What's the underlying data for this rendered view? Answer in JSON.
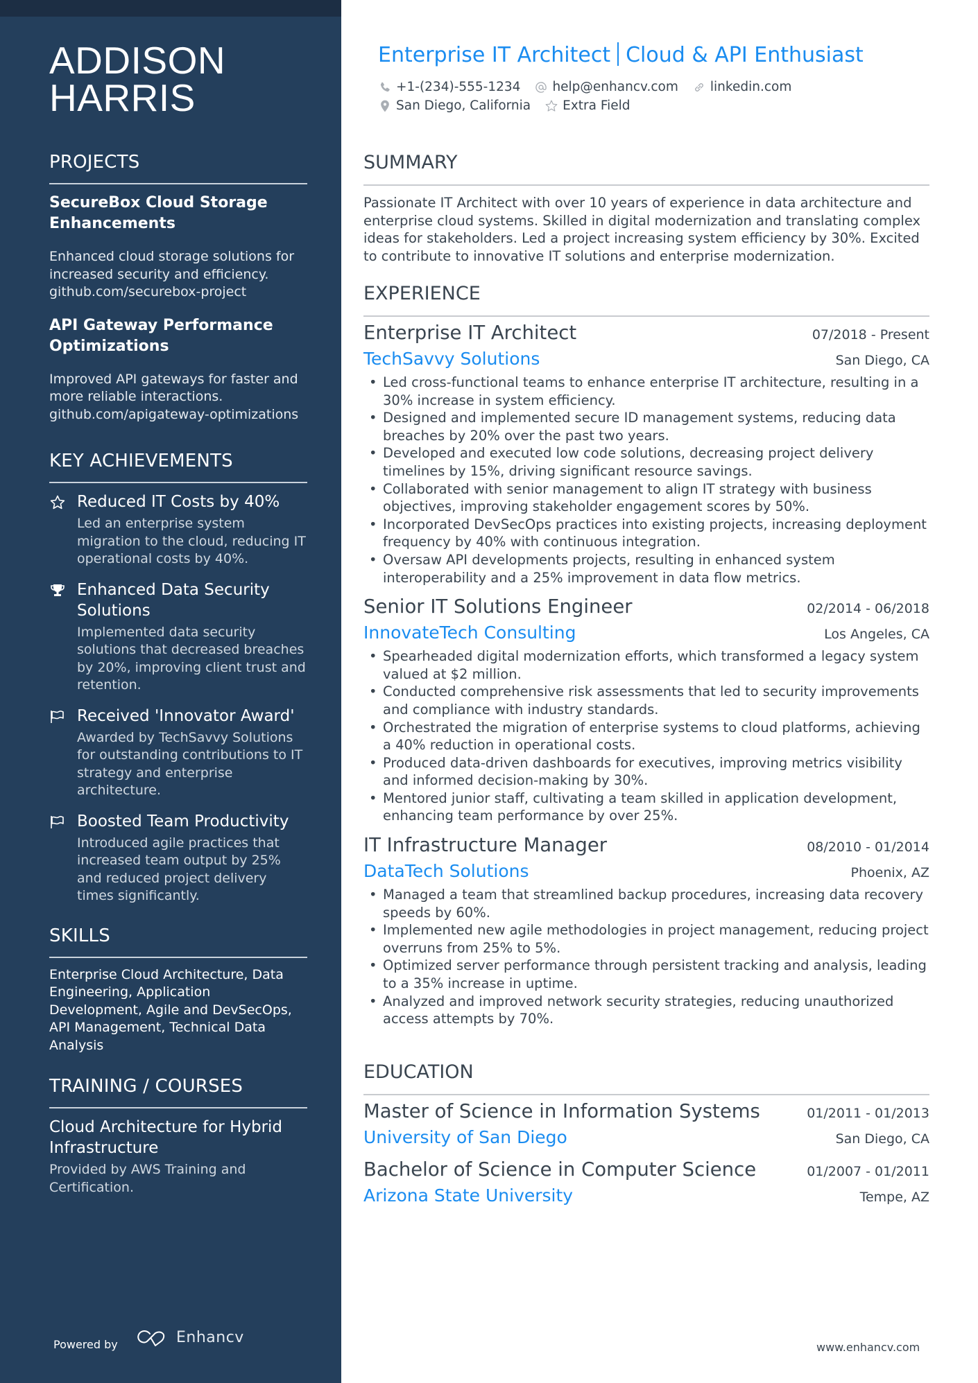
{
  "sidebar": {
    "name_line1": "ADDISON",
    "name_line2": "HARRIS",
    "projects": {
      "title": "PROJECTS",
      "items": [
        {
          "title": "SecureBox Cloud Storage Enhancements",
          "description": "Enhanced cloud storage solutions for increased security and efficiency.",
          "link": "github.com/securebox-project"
        },
        {
          "title": "API Gateway Performance Optimizations",
          "description": "Improved API gateways for faster and more reliable interactions.",
          "link": "github.com/apigateway-optimizations"
        }
      ]
    },
    "achievements": {
      "title": "KEY ACHIEVEMENTS",
      "items": [
        {
          "icon": "star-icon",
          "title": "Reduced IT Costs by 40%",
          "description": "Led an enterprise system migration to the cloud, reducing IT operational costs by 40%."
        },
        {
          "icon": "trophy-icon",
          "title": "Enhanced Data Security Solutions",
          "description": "Implemented data security solutions that decreased breaches by 20%, improving client trust and retention."
        },
        {
          "icon": "flag-icon",
          "title": "Received 'Innovator Award'",
          "description": "Awarded by TechSavvy Solutions for outstanding contributions to IT strategy and enterprise architecture."
        },
        {
          "icon": "flag-icon",
          "title": "Boosted Team Productivity",
          "description": "Introduced agile practices that increased team output by 25% and reduced project delivery times significantly."
        }
      ]
    },
    "skills": {
      "title": "SKILLS",
      "text": "Enterprise Cloud Architecture, Data Engineering, Application Development, Agile and DevSecOps, API Management, Technical Data Analysis"
    },
    "training": {
      "title": "TRAINING / COURSES",
      "items": [
        {
          "title": "Cloud Architecture for Hybrid Infrastructure",
          "description": "Provided by AWS Training and Certification."
        }
      ]
    },
    "footer": {
      "powered_by": "Powered by",
      "brand": "Enhancv"
    }
  },
  "header": {
    "headline_part1": "Enterprise IT Architect",
    "headline_part2": "Cloud & API Enthusiast",
    "phone": "+1-(234)-555-1234",
    "email": "help@enhancv.com",
    "linkedin": "linkedin.com",
    "location": "San Diego, California",
    "extra": "Extra Field"
  },
  "summary": {
    "title": "SUMMARY",
    "text": "Passionate IT Architect with over 10 years of experience in data architecture and enterprise cloud systems. Skilled in digital modernization and translating complex ideas for stakeholders. Led a project increasing system efficiency by 30%. Excited to contribute to innovative IT solutions and enterprise modernization."
  },
  "experience": {
    "title": "EXPERIENCE",
    "jobs": [
      {
        "title": "Enterprise IT Architect",
        "dates": "07/2018 - Present",
        "company": "TechSavvy Solutions",
        "location": "San Diego, CA",
        "bullets": [
          "Led cross-functional teams to enhance enterprise IT architecture, resulting in a 30% increase in system efficiency.",
          "Designed and implemented secure ID management systems, reducing data breaches by 20% over the past two years.",
          "Developed and executed low code solutions, decreasing project delivery timelines by 15%, driving significant resource savings.",
          "Collaborated with senior management to align IT strategy with business objectives, improving stakeholder engagement scores by 50%.",
          "Incorporated DevSecOps practices into existing projects, increasing deployment frequency by 40% with continuous integration.",
          "Oversaw API developments projects, resulting in enhanced system interoperability and a 25% improvement in data flow metrics."
        ]
      },
      {
        "title": "Senior IT Solutions Engineer",
        "dates": "02/2014 - 06/2018",
        "company": "InnovateTech Consulting",
        "location": "Los Angeles, CA",
        "bullets": [
          "Spearheaded digital modernization efforts, which transformed a legacy system valued at $2 million.",
          "Conducted comprehensive risk assessments that led to security improvements and compliance with industry standards.",
          "Orchestrated the migration of enterprise systems to cloud platforms, achieving a 40% reduction in operational costs.",
          "Produced data-driven dashboards for executives, improving metrics visibility and informed decision-making by 30%.",
          "Mentored junior staff, cultivating a team skilled in application development, enhancing team performance by over 25%."
        ]
      },
      {
        "title": "IT Infrastructure Manager",
        "dates": "08/2010 - 01/2014",
        "company": "DataTech Solutions",
        "location": "Phoenix, AZ",
        "bullets": [
          "Managed a team that streamlined backup procedures, increasing data recovery speeds by 60%.",
          "Implemented new agile methodologies in project management, reducing project overruns from 25% to 5%.",
          "Optimized server performance through persistent tracking and analysis, leading to a 35% increase in uptime.",
          "Analyzed and improved network security strategies, reducing unauthorized access attempts by 70%."
        ]
      }
    ]
  },
  "education": {
    "title": "EDUCATION",
    "items": [
      {
        "degree": "Master of Science in Information Systems",
        "dates": "01/2011 - 01/2013",
        "school": "University of San Diego",
        "location": "San Diego, CA"
      },
      {
        "degree": "Bachelor of Science in Computer Science",
        "dates": "01/2007 - 01/2011",
        "school": "Arizona State University",
        "location": "Tempe, AZ"
      }
    ]
  },
  "footer": {
    "url": "www.enhancv.com"
  },
  "colors": {
    "sidebar_bg": "#243f5c",
    "sidebar_topband": "#1c2e44",
    "accent": "#1a8cf0",
    "text": "#3a4550"
  }
}
